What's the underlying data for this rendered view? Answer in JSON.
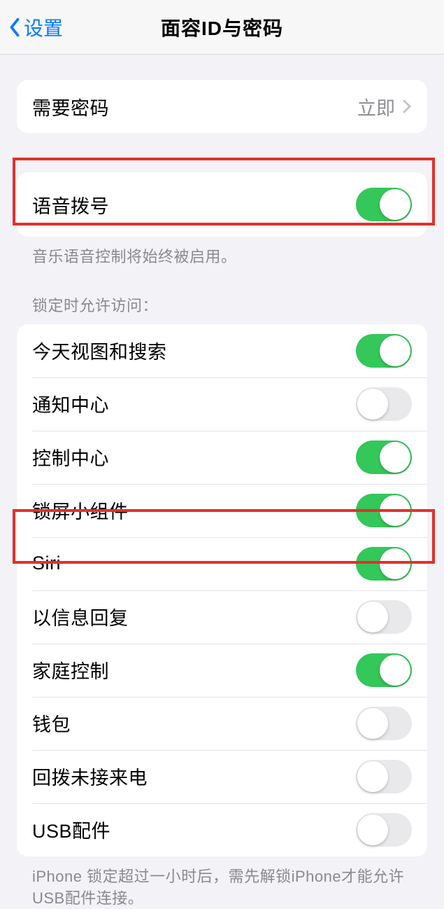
{
  "nav": {
    "back_label": "设置",
    "title": "面容ID与密码"
  },
  "require_passcode": {
    "label": "需要密码",
    "value": "立即"
  },
  "voice_dial": {
    "label": "语音拨号",
    "footer": "音乐语音控制将始终被启用。",
    "on": true
  },
  "access_header": "锁定时允许访问：",
  "access": [
    {
      "label": "今天视图和搜索",
      "on": true
    },
    {
      "label": "通知中心",
      "on": false
    },
    {
      "label": "控制中心",
      "on": true
    },
    {
      "label": "锁屏小组件",
      "on": true
    },
    {
      "label": "Siri",
      "on": true
    },
    {
      "label": "以信息回复",
      "on": false
    },
    {
      "label": "家庭控制",
      "on": true
    },
    {
      "label": "钱包",
      "on": false
    },
    {
      "label": "回拨未接来电",
      "on": false
    },
    {
      "label": "USB配件",
      "on": false
    }
  ],
  "usb_footer": "iPhone 锁定超过一小时后，需先解锁iPhone才能允许USB配件连接。"
}
